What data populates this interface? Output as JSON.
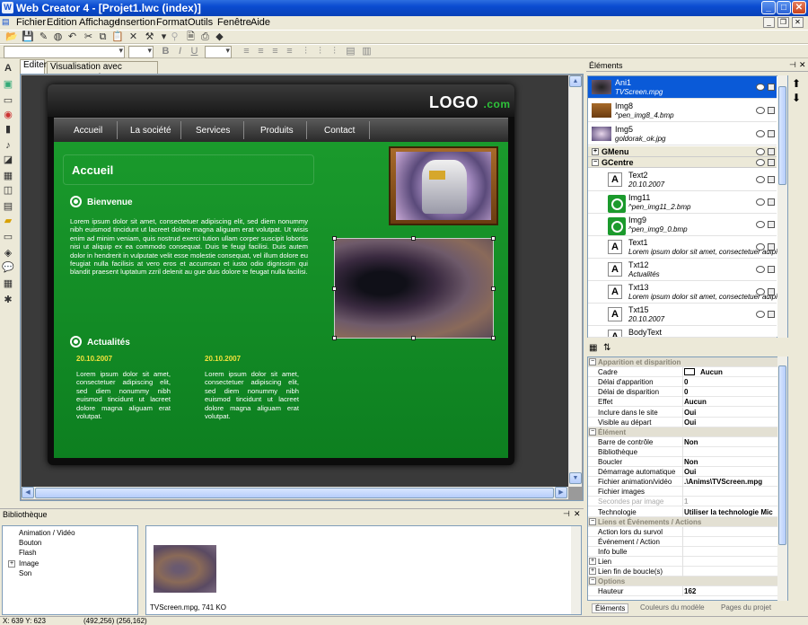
{
  "window": {
    "title": "Web Creator 4 - [Projet1.lwc (index)]"
  },
  "menu": [
    "Fichier",
    "Edition",
    "Affichage",
    "Insertion",
    "Format",
    "Outils",
    "Fenêtre",
    "Aide"
  ],
  "tabs": [
    {
      "label": "Editer"
    },
    {
      "label": "Visualisation avec Internet Explorer"
    }
  ],
  "page": {
    "logo": "LOGO",
    "logo_suffix": ".com",
    "nav": [
      "Accueil",
      "La société",
      "Services",
      "Produits",
      "Contact"
    ],
    "heading": "Accueil",
    "welcome_title": "Bienvenue",
    "welcome_text": "Lorem ipsum dolor sit amet, consectetuer adipiscing elit, sed diem nonummy nibh euismod tincidunt ut lacreet dolore magna aliguam erat volutpat. Ut wisis enim ad minim veniam, quis nostrud exerci tution ullam corper suscipit lobortis nisi ut aliquip ex ea commodo consequat. Duis te feugi facilisi. Duis autem dolor in hendrerit in vulputate velit esse molestie consequat, vel illum dolore eu feugiat nulla facilisis at vero eros et accumsan et iusto odio dignissim qui blandit praesent luptatum zzril delenit au gue duis dolore te feugat nulla facilisi.",
    "news_title": "Actualités",
    "news": [
      {
        "date": "20.10.2007",
        "text": "Lorem ipsum dolor sit amet, consectetuer adipiscing elit, sed diem nonummy nibh euismod tincidunt ut lacreet dolore magna aliguam erat volutpat."
      },
      {
        "date": "20.10.2007",
        "text": "Lorem ipsum dolor sit amet, consectetuer adipiscing elit, sed diem nonummy nibh euismod tincidunt ut lacreet dolore magna aliguam erat volutpat."
      }
    ]
  },
  "library": {
    "title": "Bibliothèque",
    "tree": [
      "Animation / Vidéo",
      "Bouton",
      "Flash",
      "Image",
      "Son"
    ],
    "thumb_caption": "TVScreen.mpg, 741 KO"
  },
  "status": {
    "cursor": "X: 639  Y: 623",
    "pos": "(492,256)  (256,162)"
  },
  "elements": {
    "title": "Éléments",
    "items": [
      {
        "name": "Ani1",
        "sub": "TVScreen.mpg"
      },
      {
        "name": "Img8",
        "sub": "^pen_img8_4.bmp"
      },
      {
        "name": "Img5",
        "sub": "goldorak_ok.jpg"
      },
      {
        "name": "GMenu"
      },
      {
        "name": "GCentre"
      },
      {
        "name": "Text2",
        "sub": "20.10.2007"
      },
      {
        "name": "Img11",
        "sub": "^pen_img11_2.bmp"
      },
      {
        "name": "Img9",
        "sub": "^pen_img9_0.bmp"
      },
      {
        "name": "Text1",
        "sub": "Lorem ipsum dolor sit amet, consectetuer adipisc"
      },
      {
        "name": "Txt12",
        "sub": "Actualités"
      },
      {
        "name": "Txt13",
        "sub": "Lorem ipsum dolor sit amet, consectetuer adipisc"
      },
      {
        "name": "Txt15",
        "sub": "20.10.2007"
      },
      {
        "name": "BodyText"
      }
    ]
  },
  "properties": [
    {
      "k": "Apparition et disparition",
      "cat": true
    },
    {
      "k": "Cadre",
      "v": "Aucun"
    },
    {
      "k": "Délai d'apparition",
      "v": "0"
    },
    {
      "k": "Délai de disparition",
      "v": "0"
    },
    {
      "k": "Effet",
      "v": "Aucun"
    },
    {
      "k": "Inclure dans le site",
      "v": "Oui"
    },
    {
      "k": "Visible au départ",
      "v": "Oui"
    },
    {
      "k": "Élément",
      "cat": true
    },
    {
      "k": "Barre de contrôle",
      "v": "Non"
    },
    {
      "k": "Bibliothèque",
      "v": ""
    },
    {
      "k": "Boucler",
      "v": "Non"
    },
    {
      "k": "Démarrage automatique",
      "v": "Oui"
    },
    {
      "k": "Fichier animation/vidéo",
      "v": ".\\Anims\\TVScreen.mpg"
    },
    {
      "k": "Fichier images",
      "v": ""
    },
    {
      "k": "Secondes par image",
      "v": "1",
      "dis": true
    },
    {
      "k": "Technologie",
      "v": "Utiliser la technologie Mic"
    },
    {
      "k": "Liens et Événements / Actions",
      "cat": true
    },
    {
      "k": "Action lors du survol",
      "v": ""
    },
    {
      "k": "Événement / Action",
      "v": ""
    },
    {
      "k": "Info bulle",
      "v": ""
    },
    {
      "k": "Lien",
      "v": "",
      "ex": true
    },
    {
      "k": "Lien fin de boucle(s)",
      "v": "",
      "ex": true
    },
    {
      "k": "Options",
      "cat": true
    },
    {
      "k": "Hauteur",
      "v": "162"
    }
  ],
  "bottom_tabs": [
    "Éléments",
    "Couleurs du modèle",
    "Pages du projet"
  ]
}
